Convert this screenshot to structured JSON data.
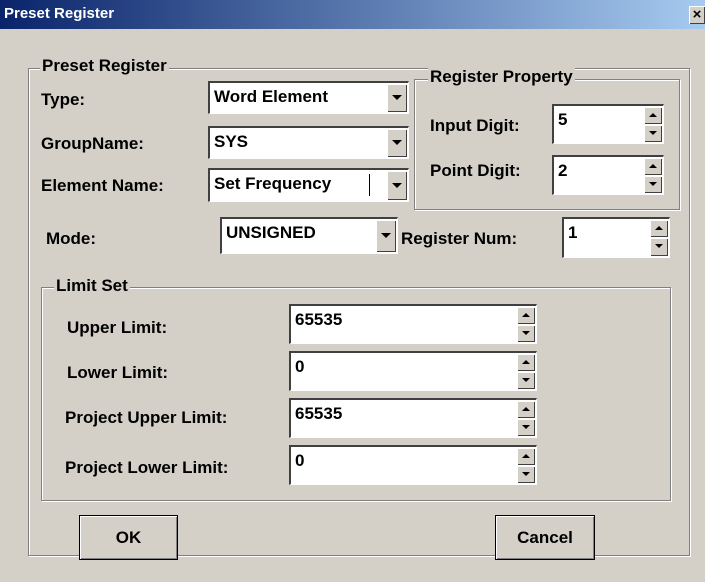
{
  "window": {
    "title": "Preset Register",
    "close_glyph": "×"
  },
  "preset_register": {
    "legend": "Preset Register",
    "type_label": "Type:",
    "type_value": "Word Element",
    "group_label": "GroupName:",
    "group_value": "SYS",
    "element_label": "Element Name:",
    "element_value": "Set Frequency",
    "mode_label": "Mode:",
    "mode_value": "UNSIGNED"
  },
  "register_property": {
    "legend": "Register Property",
    "input_digit_label": "Input Digit:",
    "input_digit_value": "5",
    "point_digit_label": "Point Digit:",
    "point_digit_value": "2",
    "register_num_label": "Register Num:",
    "register_num_value": "1"
  },
  "limit_set": {
    "legend": "Limit Set",
    "upper_label": "Upper Limit:",
    "upper_value": "65535",
    "lower_label": "Lower Limit:",
    "lower_value": "0",
    "project_upper_label": "Project Upper Limit:",
    "project_upper_value": "65535",
    "project_lower_label": "Project Lower Limit:",
    "project_lower_value": "0"
  },
  "buttons": {
    "ok": "OK",
    "cancel": "Cancel"
  }
}
